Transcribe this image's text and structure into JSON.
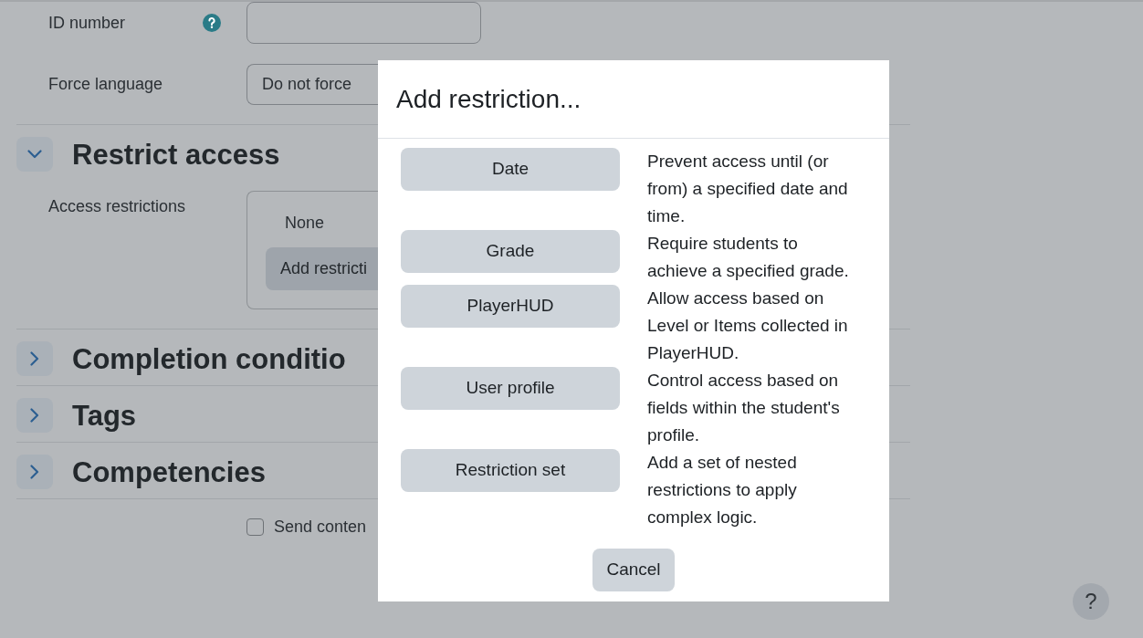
{
  "form": {
    "id_number": {
      "label": "ID number"
    },
    "force_language": {
      "label": "Force language",
      "value": "Do not force"
    },
    "sections": [
      {
        "title": "Restrict access",
        "expanded": true,
        "content": {
          "label": "Access restrictions",
          "status": "None",
          "button": "Add restricti"
        }
      },
      {
        "title": "Completion conditio",
        "expanded": false
      },
      {
        "title": "Tags",
        "expanded": false
      },
      {
        "title": "Competencies",
        "expanded": false
      }
    ],
    "send_content": {
      "label": "Send conten",
      "checked": false
    }
  },
  "dialog": {
    "title": "Add restriction...",
    "options": [
      {
        "button": "Date",
        "description": "Prevent access until (or from) a specified date and time."
      },
      {
        "button": "Grade",
        "description": "Require students to achieve a specified grade."
      },
      {
        "button": "PlayerHUD",
        "description": "Allow access based on Level or Items collected in PlayerHUD."
      },
      {
        "button": "User profile",
        "description": "Control access based on fields within the student's profile."
      },
      {
        "button": "Restriction set",
        "description": "Add a set of nested restrictions to apply complex logic."
      }
    ],
    "cancel": "Cancel"
  },
  "help_button": {
    "label": "?"
  }
}
